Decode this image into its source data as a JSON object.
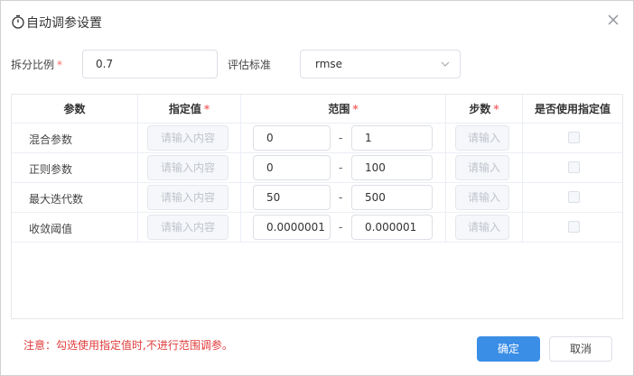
{
  "dialog": {
    "title": "自动调参设置",
    "close_icon": "close-icon",
    "title_icon": "timer-icon"
  },
  "form": {
    "split_ratio_label": "拆分比例",
    "required_mark": "*",
    "split_ratio_value": "0.7",
    "metric_label": "评估标准",
    "metric_value": "rmse"
  },
  "table": {
    "headers": {
      "param": "参数",
      "specified": "指定值",
      "range": "范围",
      "steps": "步数",
      "use_specified": "是否使用指定值"
    },
    "placeholder_specified": "请输入内容",
    "placeholder_steps": "请输入",
    "range_separator": "-",
    "rows": [
      {
        "name": "混合参数",
        "min": "0",
        "max": "1",
        "use_specified": false
      },
      {
        "name": "正则参数",
        "min": "0",
        "max": "100",
        "use_specified": false
      },
      {
        "name": "最大迭代数",
        "min": "50",
        "max": "500",
        "use_specified": false
      },
      {
        "name": "收敛阈值",
        "min": "0.0000001",
        "max": "0.000001",
        "use_specified": false
      }
    ]
  },
  "footer": {
    "note": "注意：勾选使用指定值时,不进行范围调参。",
    "confirm_label": "确定",
    "cancel_label": "取消"
  },
  "colors": {
    "primary": "#3a8ee6",
    "required": "#f56c6c",
    "note": "#e03a3a"
  }
}
